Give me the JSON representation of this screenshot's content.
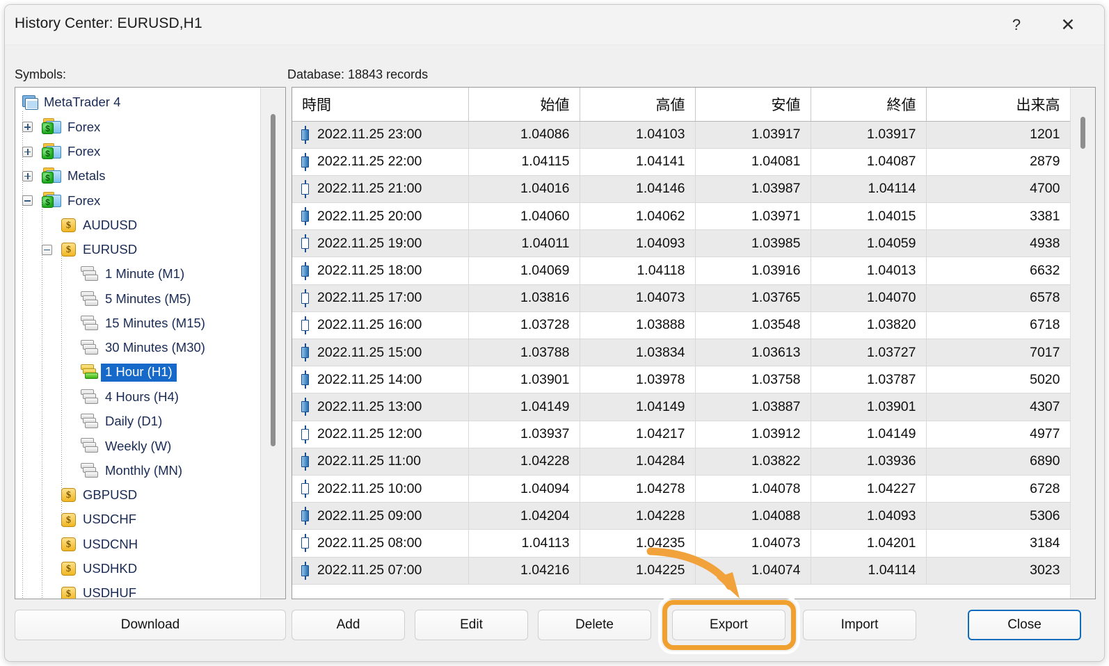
{
  "window": {
    "title": "History Center: EURUSD,H1",
    "help_icon": "question-mark-icon",
    "close_icon": "close-icon"
  },
  "labels": {
    "symbols": "Symbols:",
    "database": "Database: 18843 records"
  },
  "tree": {
    "root": {
      "label": "MetaTrader 4",
      "icon": "metatrader-icon"
    },
    "items": [
      {
        "label": "Forex",
        "level": 1,
        "icon": "folder-forex-icon",
        "expander": "plus",
        "type": "group"
      },
      {
        "label": "Forex",
        "level": 1,
        "icon": "folder-forex-icon",
        "expander": "plus",
        "type": "group"
      },
      {
        "label": "Metals",
        "level": 1,
        "icon": "folder-forex-icon",
        "expander": "plus",
        "type": "group"
      },
      {
        "label": "Forex",
        "level": 1,
        "icon": "folder-forex-icon",
        "expander": "minus",
        "type": "group"
      },
      {
        "label": "AUDUSD",
        "level": 2,
        "icon": "symbol-icon",
        "expander": "none",
        "type": "symbol"
      },
      {
        "label": "EURUSD",
        "level": 2,
        "icon": "symbol-icon",
        "expander": "minus",
        "type": "symbol"
      },
      {
        "label": "1 Minute (M1)",
        "level": 3,
        "icon": "timeframe-icon",
        "expander": "none",
        "type": "timeframe",
        "selected": false
      },
      {
        "label": "5 Minutes (M5)",
        "level": 3,
        "icon": "timeframe-icon",
        "expander": "none",
        "type": "timeframe",
        "selected": false
      },
      {
        "label": "15 Minutes (M15)",
        "level": 3,
        "icon": "timeframe-icon",
        "expander": "none",
        "type": "timeframe",
        "selected": false
      },
      {
        "label": "30 Minutes (M30)",
        "level": 3,
        "icon": "timeframe-icon",
        "expander": "none",
        "type": "timeframe",
        "selected": false
      },
      {
        "label": "1 Hour (H1)",
        "level": 3,
        "icon": "timeframe-icon-active",
        "expander": "none",
        "type": "timeframe",
        "selected": true
      },
      {
        "label": "4 Hours (H4)",
        "level": 3,
        "icon": "timeframe-icon",
        "expander": "none",
        "type": "timeframe",
        "selected": false
      },
      {
        "label": "Daily (D1)",
        "level": 3,
        "icon": "timeframe-icon",
        "expander": "none",
        "type": "timeframe",
        "selected": false
      },
      {
        "label": "Weekly (W)",
        "level": 3,
        "icon": "timeframe-icon",
        "expander": "none",
        "type": "timeframe",
        "selected": false
      },
      {
        "label": "Monthly (MN)",
        "level": 3,
        "icon": "timeframe-icon",
        "expander": "none",
        "type": "timeframe",
        "selected": false
      },
      {
        "label": "GBPUSD",
        "level": 2,
        "icon": "symbol-icon",
        "expander": "none",
        "type": "symbol"
      },
      {
        "label": "USDCHF",
        "level": 2,
        "icon": "symbol-icon",
        "expander": "none",
        "type": "symbol"
      },
      {
        "label": "USDCNH",
        "level": 2,
        "icon": "symbol-icon",
        "expander": "none",
        "type": "symbol"
      },
      {
        "label": "USDHKD",
        "level": 2,
        "icon": "symbol-icon",
        "expander": "none",
        "type": "symbol"
      },
      {
        "label": "USDHUF",
        "level": 2,
        "icon": "symbol-icon",
        "expander": "none",
        "type": "symbol"
      }
    ]
  },
  "table": {
    "columns": [
      {
        "key": "time",
        "label": "時間"
      },
      {
        "key": "open",
        "label": "始値"
      },
      {
        "key": "high",
        "label": "高値"
      },
      {
        "key": "low",
        "label": "安値"
      },
      {
        "key": "close",
        "label": "終値"
      },
      {
        "key": "volume",
        "label": "出来高"
      }
    ],
    "rows": [
      {
        "time": "2022.11.25 23:00",
        "open": "1.04086",
        "high": "1.04103",
        "low": "1.03917",
        "close": "1.03917",
        "volume": "1201",
        "candle": "down"
      },
      {
        "time": "2022.11.25 22:00",
        "open": "1.04115",
        "high": "1.04141",
        "low": "1.04081",
        "close": "1.04087",
        "volume": "2879",
        "candle": "down"
      },
      {
        "time": "2022.11.25 21:00",
        "open": "1.04016",
        "high": "1.04146",
        "low": "1.03987",
        "close": "1.04114",
        "volume": "4700",
        "candle": "up"
      },
      {
        "time": "2022.11.25 20:00",
        "open": "1.04060",
        "high": "1.04062",
        "low": "1.03971",
        "close": "1.04015",
        "volume": "3381",
        "candle": "down"
      },
      {
        "time": "2022.11.25 19:00",
        "open": "1.04011",
        "high": "1.04093",
        "low": "1.03985",
        "close": "1.04059",
        "volume": "4938",
        "candle": "up"
      },
      {
        "time": "2022.11.25 18:00",
        "open": "1.04069",
        "high": "1.04118",
        "low": "1.03916",
        "close": "1.04013",
        "volume": "6632",
        "candle": "down"
      },
      {
        "time": "2022.11.25 17:00",
        "open": "1.03816",
        "high": "1.04073",
        "low": "1.03765",
        "close": "1.04070",
        "volume": "6578",
        "candle": "up"
      },
      {
        "time": "2022.11.25 16:00",
        "open": "1.03728",
        "high": "1.03888",
        "low": "1.03548",
        "close": "1.03820",
        "volume": "6718",
        "candle": "up"
      },
      {
        "time": "2022.11.25 15:00",
        "open": "1.03788",
        "high": "1.03834",
        "low": "1.03613",
        "close": "1.03727",
        "volume": "7017",
        "candle": "down"
      },
      {
        "time": "2022.11.25 14:00",
        "open": "1.03901",
        "high": "1.03978",
        "low": "1.03758",
        "close": "1.03787",
        "volume": "5020",
        "candle": "down"
      },
      {
        "time": "2022.11.25 13:00",
        "open": "1.04149",
        "high": "1.04149",
        "low": "1.03887",
        "close": "1.03901",
        "volume": "4307",
        "candle": "down"
      },
      {
        "time": "2022.11.25 12:00",
        "open": "1.03937",
        "high": "1.04217",
        "low": "1.03912",
        "close": "1.04149",
        "volume": "4977",
        "candle": "up"
      },
      {
        "time": "2022.11.25 11:00",
        "open": "1.04228",
        "high": "1.04284",
        "low": "1.03822",
        "close": "1.03936",
        "volume": "6890",
        "candle": "down"
      },
      {
        "time": "2022.11.25 10:00",
        "open": "1.04094",
        "high": "1.04278",
        "low": "1.04078",
        "close": "1.04227",
        "volume": "6728",
        "candle": "up"
      },
      {
        "time": "2022.11.25 09:00",
        "open": "1.04204",
        "high": "1.04228",
        "low": "1.04088",
        "close": "1.04093",
        "volume": "5306",
        "candle": "down"
      },
      {
        "time": "2022.11.25 08:00",
        "open": "1.04113",
        "high": "1.04235",
        "low": "1.04073",
        "close": "1.04201",
        "volume": "3184",
        "candle": "up"
      },
      {
        "time": "2022.11.25 07:00",
        "open": "1.04216",
        "high": "1.04225",
        "low": "1.04074",
        "close": "1.04114",
        "volume": "3023",
        "candle": "down"
      }
    ]
  },
  "buttons": {
    "download": "Download",
    "add": "Add",
    "edit": "Edit",
    "delete": "Delete",
    "export": "Export",
    "import": "Import",
    "close": "Close"
  },
  "annotation": {
    "highlight_color": "#f0a02f",
    "arrow_color": "#f2a23a",
    "target": "export-button"
  }
}
